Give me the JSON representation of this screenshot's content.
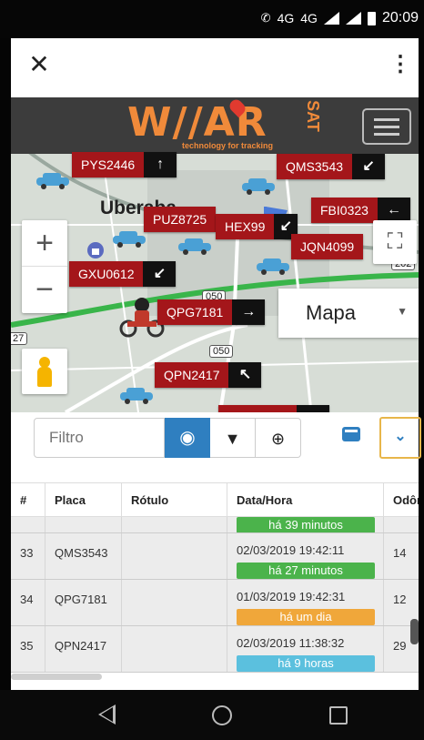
{
  "status_bar": {
    "network1": "4G",
    "network2": "4G",
    "time": "20:09"
  },
  "colors": {
    "plate_red": "#a4161a",
    "accent_blue": "#2f7fc0",
    "badge_green": "#4bb34b",
    "badge_orange": "#f0a73a",
    "badge_cyan": "#5bc0de",
    "logo_orange": "#f08a3a"
  },
  "map": {
    "logo": {
      "main": "W//AR",
      "suffix": "SAT",
      "tagline": "technology for tracking"
    },
    "city_label": "Uberaba",
    "road_shields": [
      "050",
      "202",
      "27"
    ],
    "plates": [
      {
        "plate": "PYS2446",
        "arrow": "↑"
      },
      {
        "plate": "QMS3543",
        "arrow": "↙"
      },
      {
        "plate": "FBI0323",
        "arrow": "←"
      },
      {
        "plate": "PUZ8725",
        "arrow": ""
      },
      {
        "plate": "HEX99",
        "arrow": "↙"
      },
      {
        "plate": "JQN4099",
        "arrow": ""
      },
      {
        "plate": "GXU0612",
        "arrow": "↙"
      },
      {
        "plate": "QPG7181",
        "arrow": "→"
      },
      {
        "plate": "QPN2417",
        "arrow": "↖"
      }
    ],
    "zoom_in": "+",
    "zoom_out": "−",
    "map_type": "Mapa"
  },
  "filter": {
    "placeholder": "Filtro"
  },
  "table": {
    "columns": [
      "#",
      "Placa",
      "Rótulo",
      "Data/Hora",
      "Odôm"
    ],
    "partial_badge": "há 39 minutos",
    "rows": [
      {
        "num": "33",
        "placa": "QMS3543",
        "rotulo": "",
        "datetime": "02/03/2019 19:42:11",
        "badge": "há 27 minutos",
        "badge_color": "green",
        "odom": "14"
      },
      {
        "num": "34",
        "placa": "QPG7181",
        "rotulo": "",
        "datetime": "01/03/2019 19:42:31",
        "badge": "há um dia",
        "badge_color": "orange",
        "odom": "12"
      },
      {
        "num": "35",
        "placa": "QPN2417",
        "rotulo": "",
        "datetime": "02/03/2019 11:38:32",
        "badge": "há 9 horas",
        "badge_color": "cyan",
        "odom": "29"
      }
    ]
  }
}
